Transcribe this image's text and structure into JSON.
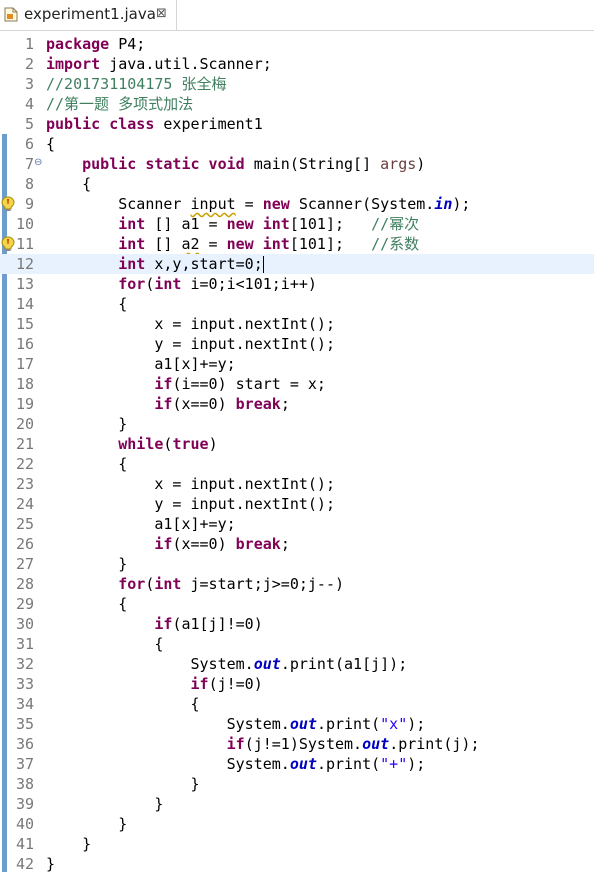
{
  "tab": {
    "title": "experiment1.java",
    "close_glyph": "⊠",
    "icon": "java-file-icon"
  },
  "editor": {
    "current_line": 12,
    "lines": [
      [
        [
          "kw",
          "package"
        ],
        [
          "t",
          " P4;"
        ]
      ],
      [
        [
          "kw",
          "import"
        ],
        [
          "t",
          " java.util.Scanner;"
        ]
      ],
      [
        [
          "cm",
          "//201731104175 张全梅"
        ]
      ],
      [
        [
          "cm",
          "//第一题 多项式加法"
        ]
      ],
      [
        [
          "kw",
          "public class"
        ],
        [
          "t",
          " experiment1"
        ]
      ],
      [
        [
          "t",
          "{"
        ]
      ],
      [
        [
          "t",
          "    "
        ],
        [
          "kw",
          "public static void"
        ],
        [
          "t",
          " main(String[] "
        ],
        [
          "pr",
          "args"
        ],
        [
          "t",
          ")"
        ]
      ],
      [
        [
          "t",
          "    {"
        ]
      ],
      [
        [
          "t",
          "        Scanner "
        ],
        [
          "w",
          "input"
        ],
        [
          "t",
          " = "
        ],
        [
          "kw",
          "new"
        ],
        [
          "t",
          " Scanner(System."
        ],
        [
          "fd",
          "in"
        ],
        [
          "t",
          ");"
        ]
      ],
      [
        [
          "t",
          "        "
        ],
        [
          "kw",
          "int"
        ],
        [
          "t",
          " [] a1 = "
        ],
        [
          "kw",
          "new int"
        ],
        [
          "t",
          "[101];   "
        ],
        [
          "cm",
          "//幂次"
        ]
      ],
      [
        [
          "t",
          "        "
        ],
        [
          "kw",
          "int"
        ],
        [
          "t",
          " [] "
        ],
        [
          "w",
          "a2"
        ],
        [
          "t",
          " = "
        ],
        [
          "kw",
          "new int"
        ],
        [
          "t",
          "[101];   "
        ],
        [
          "cm",
          "//系数"
        ]
      ],
      [
        [
          "t",
          "        "
        ],
        [
          "kw",
          "int"
        ],
        [
          "t",
          " x,y,start=0;"
        ],
        [
          "caret",
          ""
        ]
      ],
      [
        [
          "t",
          "        "
        ],
        [
          "kw",
          "for"
        ],
        [
          "t",
          "("
        ],
        [
          "kw",
          "int"
        ],
        [
          "t",
          " i=0;i<101;i++)"
        ]
      ],
      [
        [
          "t",
          "        {"
        ]
      ],
      [
        [
          "t",
          "            x = input.nextInt();"
        ]
      ],
      [
        [
          "t",
          "            y = input.nextInt();"
        ]
      ],
      [
        [
          "t",
          "            a1[x]+=y;"
        ]
      ],
      [
        [
          "t",
          "            "
        ],
        [
          "kw",
          "if"
        ],
        [
          "t",
          "(i==0) start = x;"
        ]
      ],
      [
        [
          "t",
          "            "
        ],
        [
          "kw",
          "if"
        ],
        [
          "t",
          "(x==0) "
        ],
        [
          "kw",
          "break"
        ],
        [
          "t",
          ";"
        ]
      ],
      [
        [
          "t",
          "        }"
        ]
      ],
      [
        [
          "t",
          "        "
        ],
        [
          "kw",
          "while"
        ],
        [
          "t",
          "("
        ],
        [
          "kw",
          "true"
        ],
        [
          "t",
          ")"
        ]
      ],
      [
        [
          "t",
          "        {"
        ]
      ],
      [
        [
          "t",
          "            x = input.nextInt();"
        ]
      ],
      [
        [
          "t",
          "            y = input.nextInt();"
        ]
      ],
      [
        [
          "t",
          "            a1[x]+=y;"
        ]
      ],
      [
        [
          "t",
          "            "
        ],
        [
          "kw",
          "if"
        ],
        [
          "t",
          "(x==0) "
        ],
        [
          "kw",
          "break"
        ],
        [
          "t",
          ";"
        ]
      ],
      [
        [
          "t",
          "        }"
        ]
      ],
      [
        [
          "t",
          "        "
        ],
        [
          "kw",
          "for"
        ],
        [
          "t",
          "("
        ],
        [
          "kw",
          "int"
        ],
        [
          "t",
          " j=start;j>=0;j--)"
        ]
      ],
      [
        [
          "t",
          "        {"
        ]
      ],
      [
        [
          "t",
          "            "
        ],
        [
          "kw",
          "if"
        ],
        [
          "t",
          "(a1[j]!=0)"
        ]
      ],
      [
        [
          "t",
          "            {"
        ]
      ],
      [
        [
          "t",
          "                System."
        ],
        [
          "fd",
          "out"
        ],
        [
          "t",
          ".print(a1[j]);"
        ]
      ],
      [
        [
          "t",
          "                "
        ],
        [
          "kw",
          "if"
        ],
        [
          "t",
          "(j!=0)"
        ]
      ],
      [
        [
          "t",
          "                {"
        ]
      ],
      [
        [
          "t",
          "                    System."
        ],
        [
          "fd",
          "out"
        ],
        [
          "t",
          ".print("
        ],
        [
          "st",
          "\"x\""
        ],
        [
          "t",
          ");"
        ]
      ],
      [
        [
          "t",
          "                    "
        ],
        [
          "kw",
          "if"
        ],
        [
          "t",
          "(j!=1)System."
        ],
        [
          "fd",
          "out"
        ],
        [
          "t",
          ".print(j);"
        ]
      ],
      [
        [
          "t",
          "                    System."
        ],
        [
          "fd",
          "out"
        ],
        [
          "t",
          ".print("
        ],
        [
          "st",
          "\"+\""
        ],
        [
          "t",
          ");"
        ]
      ],
      [
        [
          "t",
          "                }"
        ]
      ],
      [
        [
          "t",
          "            }"
        ]
      ],
      [
        [
          "t",
          "        }"
        ]
      ],
      [
        [
          "t",
          "    }"
        ]
      ],
      [
        [
          "t",
          "}"
        ]
      ]
    ],
    "fold_lines": [
      7
    ],
    "warning_lines": [
      9,
      11
    ],
    "ruler_blocks": [
      [
        6,
        42
      ]
    ],
    "colors": {
      "keyword": "#7f0055",
      "comment": "#3f7f5f",
      "string": "#2a00ff",
      "static_field": "#0000c0",
      "parameter": "#6a3e3e",
      "current_line_bg": "#e8f2fe"
    }
  }
}
